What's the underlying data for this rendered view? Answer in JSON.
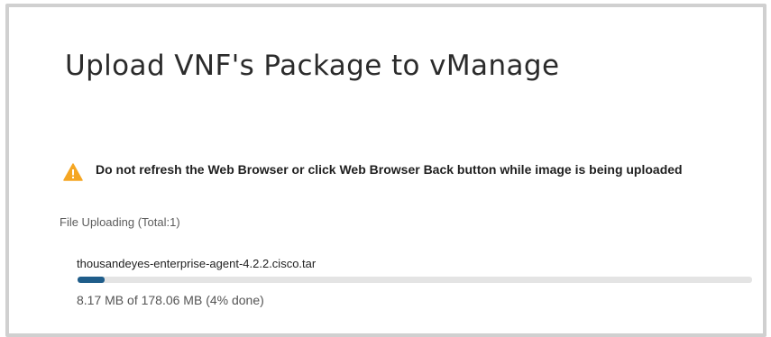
{
  "dialog": {
    "title": "Upload VNF's Package to vManage"
  },
  "warning": {
    "icon": "warning-icon",
    "color": "#f5a623",
    "text": "Do not refresh the Web Browser or click Web Browser Back button while image is being uploaded"
  },
  "upload": {
    "status_label": "File Uploading (Total:1)",
    "file_name": "thousandeyes-enterprise-agent-4.2.2.cisco.tar",
    "progress_text": "8.17 MB of 178.06 MB (4% done)",
    "progress_fraction": 0.04,
    "progress_color": "#1f5d8a"
  }
}
